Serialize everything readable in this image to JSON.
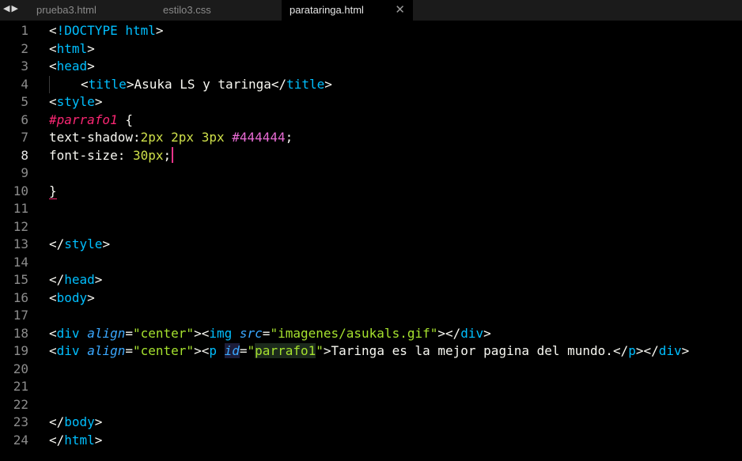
{
  "tabs": [
    {
      "label": "prueba3.html",
      "active": false
    },
    {
      "label": "estilo3.css",
      "active": false
    },
    {
      "label": "parataringa.html",
      "active": true
    }
  ],
  "nav_icons": [
    "arrow-left-icon",
    "arrow-right-icon"
  ],
  "close_icon": "close-icon",
  "active_line": 8,
  "colors": {
    "background": "#000000",
    "tabbar": "#1b1b1b",
    "tag": "#00bfff",
    "string": "#a6e22e",
    "selector": "#f92672",
    "cursor": "#e8348a"
  },
  "code": {
    "line_numbers": [
      "1",
      "2",
      "3",
      "4",
      "5",
      "6",
      "7",
      "8",
      "9",
      "10",
      "11",
      "12",
      "13",
      "14",
      "15",
      "16",
      "17",
      "18",
      "19",
      "20",
      "21",
      "22",
      "23",
      "24"
    ],
    "l1": {
      "lt": "<",
      "bang": "!DOCTYPE",
      "sp": " ",
      "html": "html",
      "gt": ">"
    },
    "l2": {
      "lt": "<",
      "tag": "html",
      "gt": ">"
    },
    "l3": {
      "lt": "<",
      "tag": "head",
      "gt": ">"
    },
    "l4": {
      "lt1": "<",
      "tag1": "title",
      "gt1": ">",
      "text": "Asuka LS y taringa",
      "lt2": "</",
      "tag2": "title",
      "gt2": ">"
    },
    "l5": {
      "lt": "<",
      "tag": "style",
      "gt": ">"
    },
    "l6": {
      "selector": "#parrafo1",
      "brace": " {"
    },
    "l7": {
      "prop": "text-shadow:",
      "v1": "2px",
      "sp1": " ",
      "v2": "2px",
      "sp2": " ",
      "v3": "3px",
      "sp3": " ",
      "hex": "#444444",
      "semi": ";"
    },
    "l8": {
      "prop": "font-size: ",
      "val": "30px",
      "semi": ";"
    },
    "l10": {
      "brace": "}"
    },
    "l13": {
      "lt": "</",
      "tag": "style",
      "gt": ">"
    },
    "l15": {
      "lt": "</",
      "tag": "head",
      "gt": ">"
    },
    "l16": {
      "lt": "<",
      "tag": "body",
      "gt": ">"
    },
    "l18": {
      "lt1": "<",
      "tag1": "div",
      "sp1": " ",
      "attr1": "align",
      "eq1": "=",
      "str1": "\"center\"",
      "gt1": ">",
      "lt2": "<",
      "tag2": "img",
      "sp2": " ",
      "attr2": "src",
      "eq2": "=",
      "str2": "\"imagenes/asukals.gif\"",
      "gt2": ">",
      "lt3": "</",
      "tag3": "div",
      "gt3": ">"
    },
    "l19": {
      "lt1": "<",
      "tag1": "div",
      "sp1": " ",
      "attr1": "align",
      "eq1": "=",
      "str1": "\"center\"",
      "gt1": ">",
      "lt2": "<",
      "tag2": "p",
      "sp2": " ",
      "attr2": "id",
      "eq2": "=",
      "q1": "\"",
      "str2": "parrafo1",
      "q2": "\"",
      "gt2": ">",
      "text": "Taringa es la mejor pagina del mundo.",
      "lt3": "</",
      "tag3": "p",
      "gt3": ">",
      "lt4": "</",
      "tag4": "div",
      "gt4": ">"
    },
    "l23": {
      "lt": "</",
      "tag": "body",
      "gt": ">"
    },
    "l24": {
      "lt": "</",
      "tag": "html",
      "gt": ">"
    }
  }
}
